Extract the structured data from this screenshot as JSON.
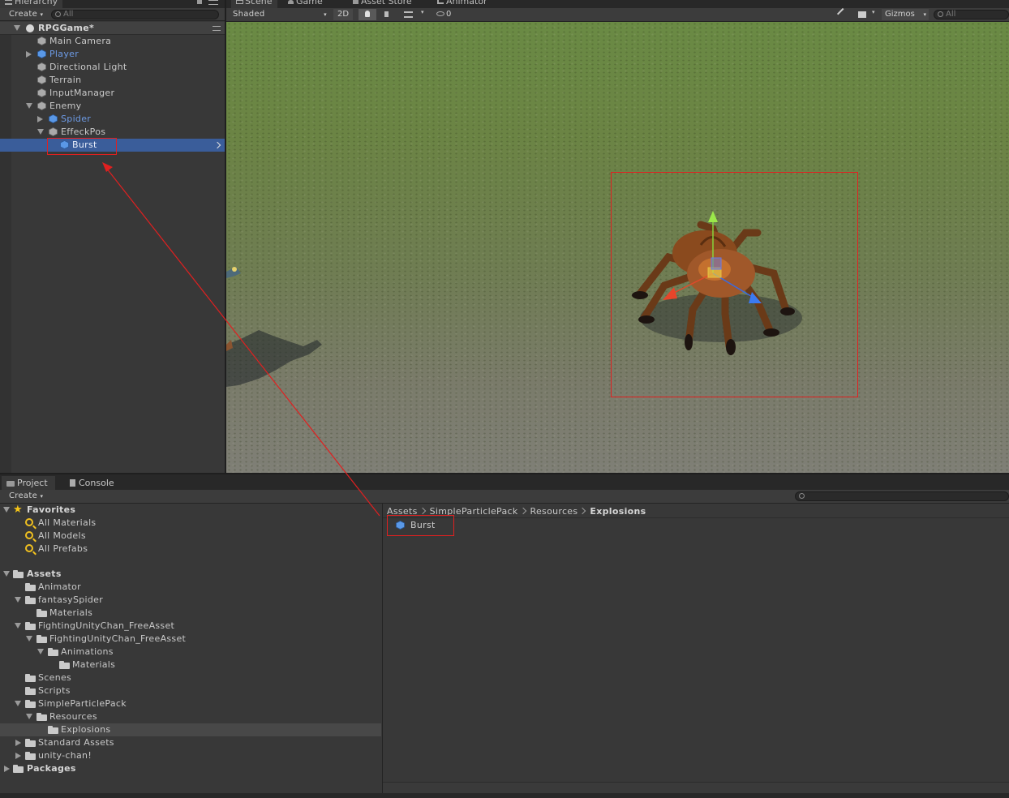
{
  "hierarchy": {
    "tab_label": "Hierarchy",
    "create_label": "Create",
    "search_placeholder": "All",
    "scene_name": "RPGGame*",
    "items": [
      {
        "label": "Main Camera"
      },
      {
        "label": "Player"
      },
      {
        "label": "Directional Light"
      },
      {
        "label": "Terrain"
      },
      {
        "label": "InputManager"
      },
      {
        "label": "Enemy"
      },
      {
        "label": "Spider"
      },
      {
        "label": "EffeckPos"
      },
      {
        "label": "Burst"
      }
    ]
  },
  "scene_view": {
    "tabs": [
      {
        "label": "Scene"
      },
      {
        "label": "Game"
      },
      {
        "label": "Asset Store"
      },
      {
        "label": "Animator"
      }
    ],
    "shading_mode": "Shaded",
    "mode_2d_label": "2D",
    "hidden_count": "0",
    "gizmos_label": "Gizmos",
    "search_placeholder": "All"
  },
  "project": {
    "tabs": [
      {
        "label": "Project"
      },
      {
        "label": "Console"
      }
    ],
    "create_label": "Create",
    "favorites": {
      "label": "Favorites",
      "items": [
        {
          "label": "All Materials"
        },
        {
          "label": "All Models"
        },
        {
          "label": "All Prefabs"
        }
      ]
    },
    "tree": [
      {
        "label": "Assets"
      },
      {
        "label": "Animator"
      },
      {
        "label": "fantasySpider"
      },
      {
        "label": "Materials"
      },
      {
        "label": "FightingUnityChan_FreeAsset"
      },
      {
        "label": "FightingUnityChan_FreeAsset"
      },
      {
        "label": "Animations"
      },
      {
        "label": "Materials"
      },
      {
        "label": "Scenes"
      },
      {
        "label": "Scripts"
      },
      {
        "label": "SimpleParticlePack"
      },
      {
        "label": "Resources"
      },
      {
        "label": "Explosions"
      },
      {
        "label": "Standard Assets"
      },
      {
        "label": "unity-chan!"
      },
      {
        "label": "Packages"
      }
    ],
    "breadcrumb": [
      "Assets",
      "SimpleParticlePack",
      "Resources",
      "Explosions"
    ],
    "asset_items": [
      {
        "label": "Burst"
      }
    ]
  },
  "colors": {
    "selection": "#3a5d9a",
    "prefab_text": "#6d9be6",
    "annotation_red": "#e02020"
  }
}
